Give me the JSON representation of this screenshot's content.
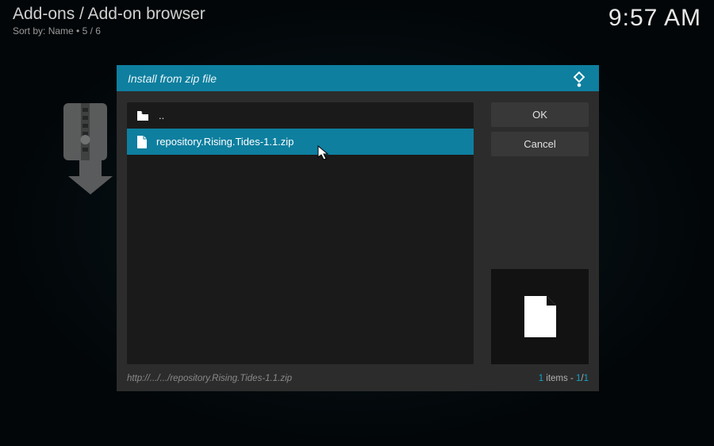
{
  "header": {
    "breadcrumb": "Add-ons / Add-on browser",
    "sort_prefix": "Sort by: ",
    "sort_value": "Name",
    "bullet": "  •  ",
    "page": "5 / 6"
  },
  "clock": "9:57 AM",
  "dialog": {
    "title": "Install from zip file",
    "parent_label": "..",
    "file_label": "repository.Rising.Tides-1.1.zip",
    "ok": "OK",
    "cancel": "Cancel",
    "path": "http://.../.../repository.Rising.Tides-1.1.zip",
    "items_num": "1",
    "items_word": " items - ",
    "items_pos": "1",
    "items_slash": "/",
    "items_total": "1"
  },
  "icons": {
    "folder": "folder-up-icon",
    "file": "file-icon",
    "logo": "kodi-logo",
    "zip_bg": "zip-install-icon",
    "preview": "file-preview-icon",
    "cursor": "mouse-cursor"
  }
}
